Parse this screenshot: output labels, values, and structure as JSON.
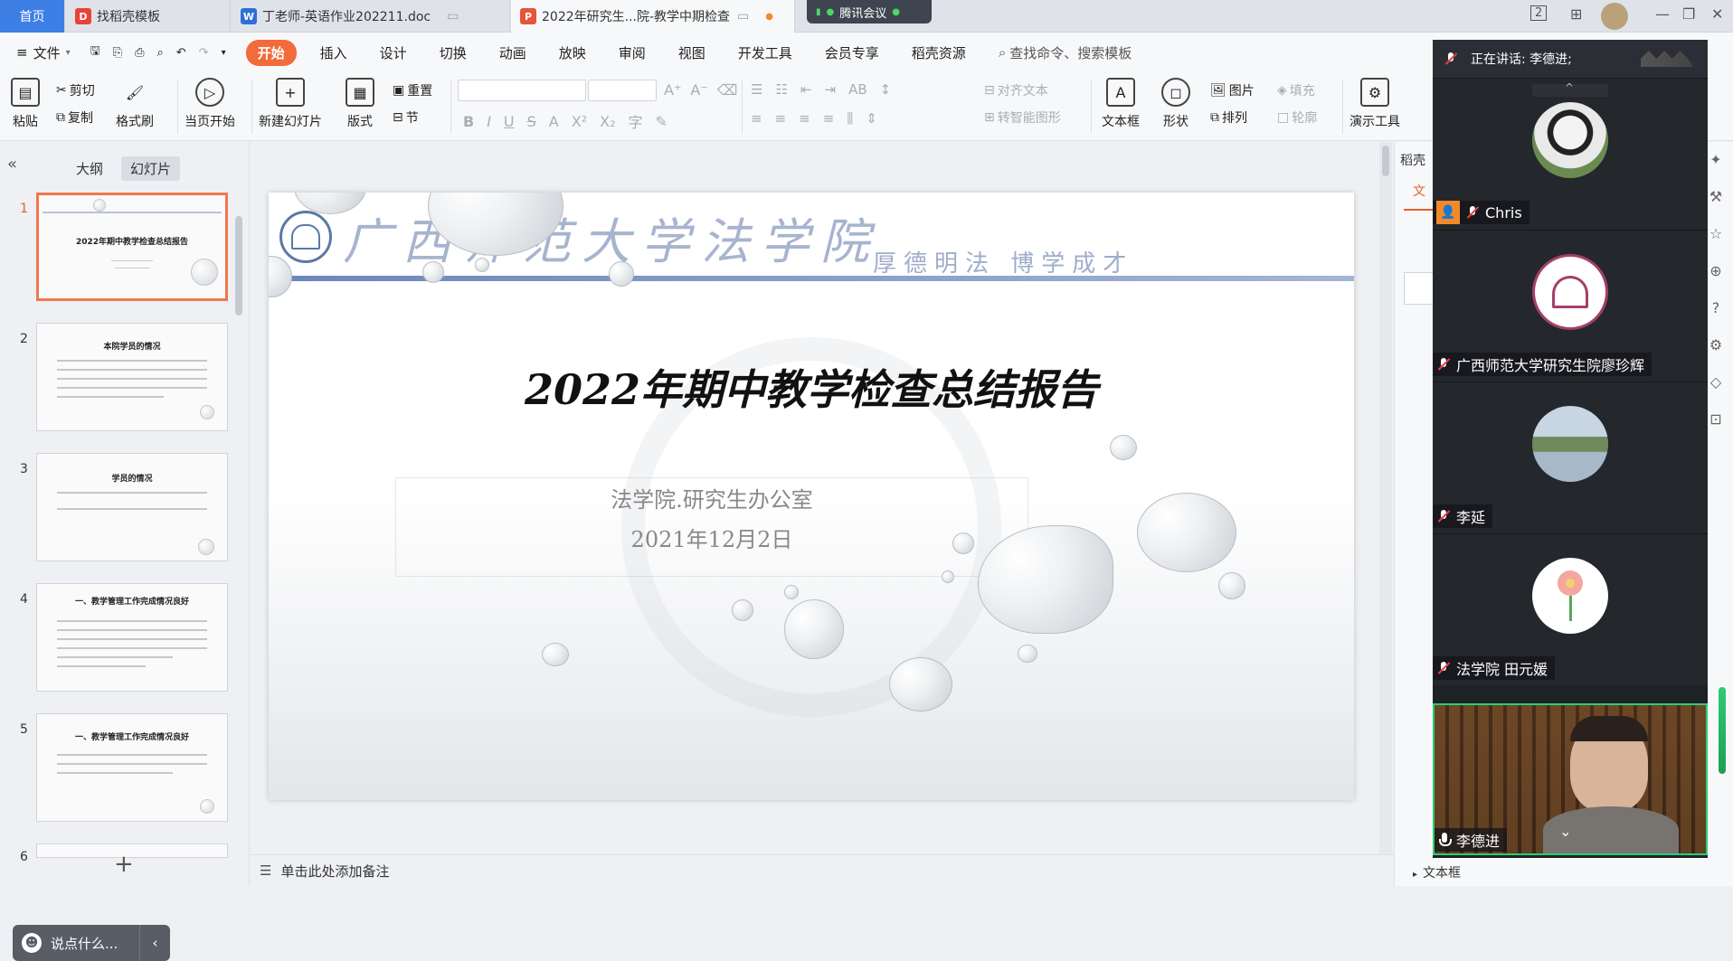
{
  "titlebar": {
    "tabs": [
      {
        "label": "首页"
      },
      {
        "label": "找稻壳模板"
      },
      {
        "label": "丁老师-英语作业202211.doc"
      },
      {
        "label": "2022年研究生...院-教学中期检查"
      }
    ],
    "meeting_label": "腾讯会议",
    "page_indicator": "2"
  },
  "menubar": {
    "file_label": "文件",
    "items": [
      "开始",
      "插入",
      "设计",
      "切换",
      "动画",
      "放映",
      "审阅",
      "视图",
      "开发工具",
      "会员专享",
      "稻壳资源"
    ],
    "search_placeholder": "查找命令、搜索模板"
  },
  "ribbon": {
    "paste": "粘贴",
    "cut": "剪切",
    "copy": "复制",
    "format_painter": "格式刷",
    "play_from_current": "当页开始",
    "new_slide": "新建幻灯片",
    "layout": "版式",
    "reset": "重置",
    "section": "节",
    "align_text": "对齐文本",
    "smart_art": "转智能图形",
    "textbox": "文本框",
    "shape": "形状",
    "picture": "图片",
    "arrange": "排列",
    "fill": "填充",
    "outline": "轮廓",
    "presenter_tools": "演示工具"
  },
  "leftpanel": {
    "tab_outline": "大纲",
    "tab_slides": "幻灯片",
    "thumbnails": [
      {
        "num": "1",
        "title": "2022年期中教学检查总结报告"
      },
      {
        "num": "2",
        "title": "本院学员的情况"
      },
      {
        "num": "3",
        "title": "学员的情况"
      },
      {
        "num": "4",
        "title": "一、教学管理工作完成情况良好"
      },
      {
        "num": "5",
        "title": "一、教学管理工作完成情况良好"
      },
      {
        "num": "6",
        "title": ""
      }
    ],
    "chat_placeholder": "说点什么..."
  },
  "slide": {
    "school_name": "广西师范大学法学院",
    "motto": "厚德明法  博学成才",
    "title": "2022年期中教学检查总结报告",
    "subtitle": "法学院.研究生办公室",
    "date": "2021年12月2日"
  },
  "notes_placeholder": "单击此处添加备注",
  "rightpanel": {
    "header": "稻壳",
    "tab": "文",
    "bottom_label": "文本框"
  },
  "meeting": {
    "speaking_label": "正在讲话: 李德进;",
    "participants": [
      {
        "name": "Chris"
      },
      {
        "name": "广西师范大学研究生院廖珍辉"
      },
      {
        "name": "李延"
      },
      {
        "name": "法学院 田元媛"
      },
      {
        "name": "李德进"
      }
    ]
  }
}
